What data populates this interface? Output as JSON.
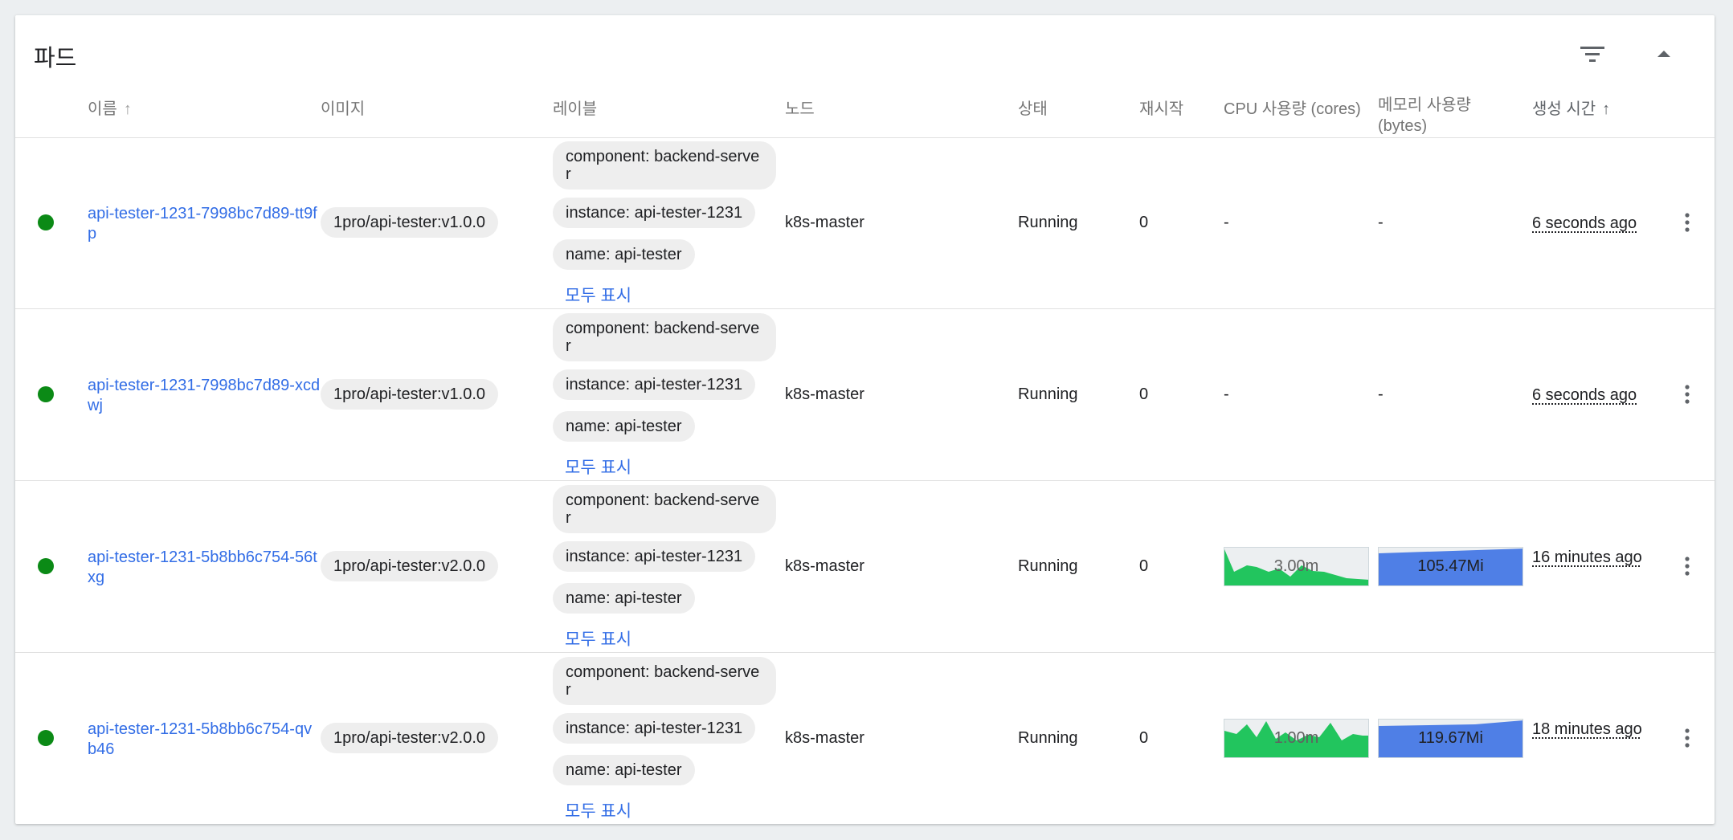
{
  "card": {
    "title": "파드",
    "icons": {
      "filter": "filter-list-icon",
      "collapse": "arrow-drop-up-icon"
    }
  },
  "columns": {
    "name": "이름",
    "image": "이미지",
    "labels": "레이블",
    "node": "노드",
    "status": "상태",
    "restarts": "재시작",
    "cpu": "CPU 사용량 (cores)",
    "memory_line1": "메모리 사용량",
    "memory_line2": "(bytes)",
    "created": "생성 시간"
  },
  "sort": {
    "name": "ascending",
    "created": "ascending (active)"
  },
  "status_color": "#0b8a16",
  "link_color": "#326de6",
  "pods": [
    {
      "name": "api-tester-1231-7998bc7d89-tt9fp",
      "image": "1pro/api-tester:v1.0.0",
      "labels": [
        "component: backend-server",
        "instance: api-tester-1231",
        "name: api-tester"
      ],
      "show_all": "모두 표시",
      "node": "k8s-master",
      "status": "Running",
      "restarts": "0",
      "cpu": "-",
      "memory": "-",
      "age": "6 seconds ago"
    },
    {
      "name": "api-tester-1231-7998bc7d89-xcdwj",
      "image": "1pro/api-tester:v1.0.0",
      "labels": [
        "component: backend-server",
        "instance: api-tester-1231",
        "name: api-tester"
      ],
      "show_all": "모두 표시",
      "node": "k8s-master",
      "status": "Running",
      "restarts": "0",
      "cpu": "-",
      "memory": "-",
      "age": "6 seconds ago"
    },
    {
      "name": "api-tester-1231-5b8bb6c754-56txg",
      "image": "1pro/api-tester:v2.0.0",
      "labels": [
        "component: backend-server",
        "instance: api-tester-1231",
        "name: api-tester"
      ],
      "show_all": "모두 표시",
      "node": "k8s-master",
      "status": "Running",
      "restarts": "0",
      "cpu": "3.00m",
      "memory": "105.47Mi",
      "age": "16 minutes ago"
    },
    {
      "name": "api-tester-1231-5b8bb6c754-qvb46",
      "image": "1pro/api-tester:v2.0.0",
      "labels": [
        "component: backend-server",
        "instance: api-tester-1231",
        "name: api-tester"
      ],
      "show_all": "모두 표시",
      "node": "k8s-master",
      "status": "Running",
      "restarts": "0",
      "cpu": "1.00m",
      "memory": "119.67Mi",
      "age": "18 minutes ago"
    }
  ]
}
